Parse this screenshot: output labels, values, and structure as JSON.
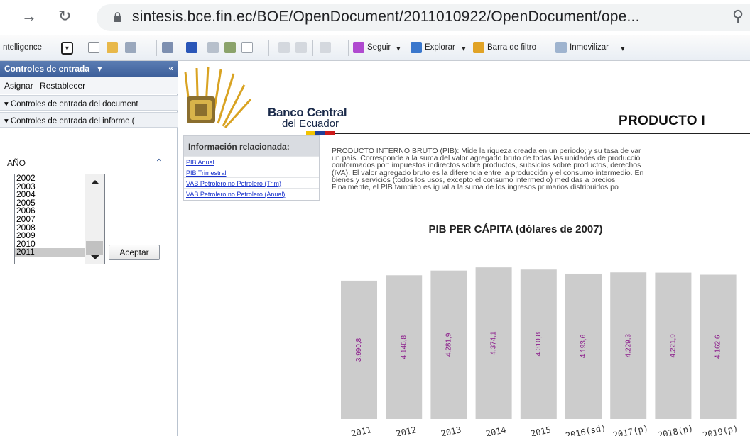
{
  "browser": {
    "url": "sintesis.bce.fin.ec/BOE/OpenDocument/2011010922/OpenDocument/ope..."
  },
  "toolbar": {
    "app_label": "ntelligence",
    "seguir": "Seguir",
    "explorar": "Explorar",
    "barra_filtro": "Barra de filtro",
    "inmovilizar": "Inmovilizar"
  },
  "left_panel": {
    "title": "Controles de entrada",
    "assign": "Asignar",
    "reset": "Restablecer",
    "section_document": "Controles de entrada del document",
    "section_report": "Controles de entrada del informe (",
    "year_label": "AÑO",
    "years": [
      "2002",
      "2003",
      "2004",
      "2005",
      "2006",
      "2007",
      "2008",
      "2009",
      "2010",
      "2011"
    ],
    "selected_year": "2011",
    "accept": "Aceptar"
  },
  "header": {
    "bank_line1": "Banco Central",
    "bank_line2": "del Ecuador",
    "report_title": "PRODUCTO I"
  },
  "related": {
    "heading": "Información relacionada:",
    "links": [
      "PIB Anual",
      "PIB Trimestral",
      "VAB Petrolero no Petrolero (Trim)",
      "VAB Petrolero no Petrolero (Anual)"
    ]
  },
  "description": {
    "lines": [
      "PRODUCTO INTERNO BRUTO (PIB): Mide la riqueza creada en un periodo; y su tasa de var",
      "un país. Corresponde a la suma del valor agregado bruto de todas las unidades de producció",
      "conformados por: impuestos indirectos sobre productos, subsidios sobre productos, derechos",
      "(IVA). El valor agregado bruto es la diferencia entre la producción y el consumo intermedio. En",
      "bienes y servicios (todos los usos, excepto el consumo intermedio) medidas a precios",
      "Finalmente, el PIB también es igual a la suma de los ingresos primarios distribuidos po"
    ]
  },
  "colors": {
    "bar": "#cccccc",
    "bar_label": "#8b1a8b",
    "panel_header": "#4a6ea8"
  },
  "chart_data": {
    "type": "bar",
    "title": "PIB PER CÁPITA (dólares de 2007)",
    "categories": [
      "2011",
      "2012",
      "2013",
      "2014",
      "2015",
      "2016(sd)",
      "2017(p)",
      "2018(p)",
      "2019(p)"
    ],
    "values": [
      3990.8,
      4146.8,
      4281.9,
      4374.1,
      4310.8,
      4193.6,
      4229.3,
      4221.9,
      4162.6
    ],
    "value_labels": [
      "3.990,8",
      "4.146,8",
      "4.281,9",
      "4.374,1",
      "4.310,8",
      "4.193,6",
      "4.229,3",
      "4.221,9",
      "4.162,6"
    ],
    "ylim": [
      0,
      4500
    ],
    "grid": false,
    "legend": "none"
  }
}
